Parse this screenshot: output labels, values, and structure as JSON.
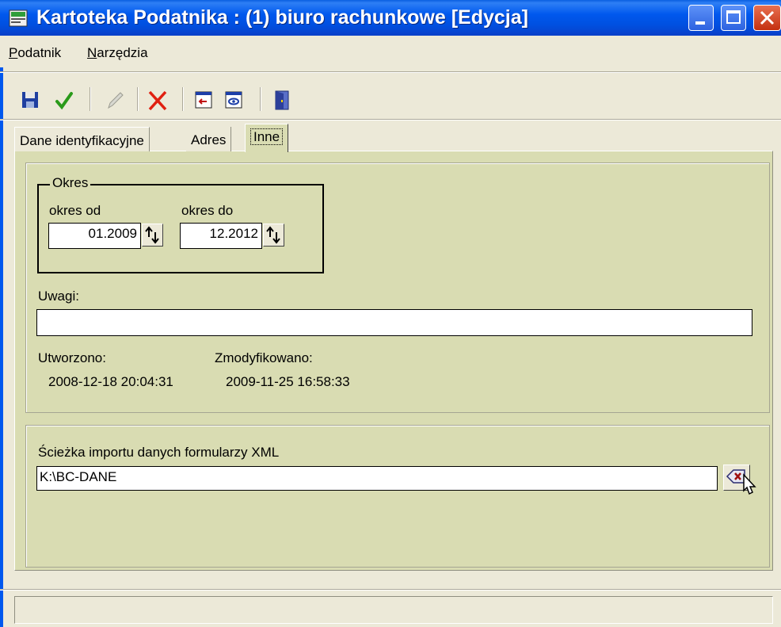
{
  "window": {
    "title": "Kartoteka Podatnika : (1) biuro rachunkowe [Edycja]"
  },
  "menu": {
    "items": [
      "Podatnik",
      "Narzędzia"
    ]
  },
  "toolbar": {
    "icons": [
      "save-icon",
      "check-icon",
      "edit-icon",
      "delete-icon",
      "export-icon",
      "preview-icon",
      "exit-icon"
    ]
  },
  "tabs": {
    "items": [
      "Dane identyfikacyjne",
      "Adres",
      "Inne"
    ],
    "active": "Inne"
  },
  "okres": {
    "legend": "Okres",
    "from_label": "okres od",
    "from_value": "01.2009",
    "to_label": "okres do",
    "to_value": "12.2012"
  },
  "uwagi": {
    "label": "Uwagi:",
    "value": ""
  },
  "meta": {
    "created_label": "Utworzono:",
    "created_value": "2008-12-18 20:04:31",
    "modified_label": "Zmodyfikowano:",
    "modified_value": "2009-11-25 16:58:33"
  },
  "import": {
    "label": "Ścieżka importu danych formularzy XML",
    "path": "K:\\BC-DANE"
  },
  "colors": {
    "titlebar": "#0058ee",
    "panel": "#d9dcb2",
    "face": "#ece9d8"
  }
}
